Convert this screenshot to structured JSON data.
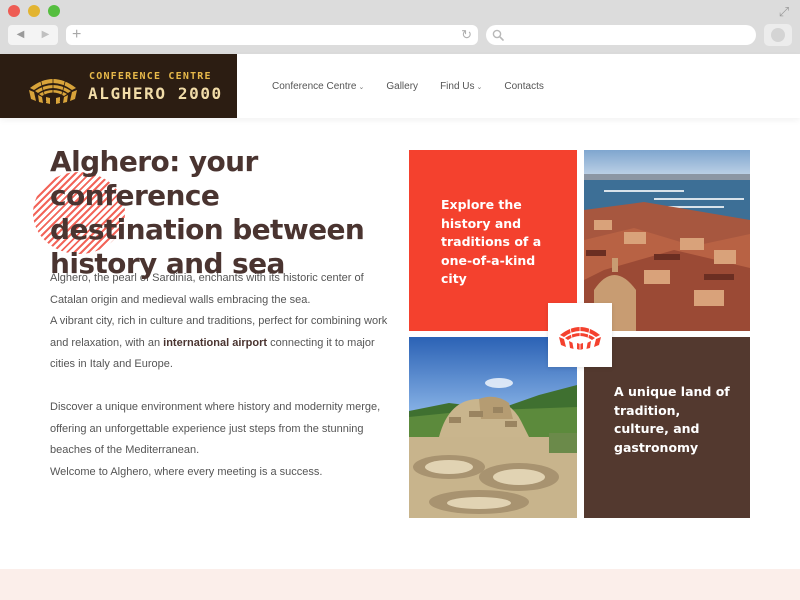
{
  "browser": {
    "back_glyph": "◀",
    "forward_glyph": "▶",
    "new_tab_glyph": "+",
    "reload_glyph": "↻",
    "expand_glyph": "⤢",
    "url": "",
    "search_placeholder": ""
  },
  "site": {
    "logo": {
      "line1": "CONFERENCE CENTRE",
      "line2": "ALGHERO 2000"
    },
    "nav": [
      {
        "label": "Conference Centre",
        "has_dropdown": true
      },
      {
        "label": "Gallery",
        "has_dropdown": false
      },
      {
        "label": "Find Us",
        "has_dropdown": true
      },
      {
        "label": "Contacts",
        "has_dropdown": false
      }
    ],
    "dropdown_glyph": "⌄"
  },
  "content": {
    "title": "Alghero: your conference destination between history and sea",
    "paragraph1_line1": "Alghero, the pearl of Sardinia, enchants with its historic center of Catalan origin and medieval walls embracing the sea.",
    "paragraph1_line2_before": "A vibrant city, rich in culture and traditions, perfect for combining work and relaxation, with an ",
    "paragraph1_line2_bold": "international airport",
    "paragraph1_line2_after": " connecting it to major cities in Italy and Europe.",
    "paragraph2_line1": "Discover a unique environment where history and modernity merge, offering an unforgettable experience just steps from the stunning beaches of the Mediterranean.",
    "paragraph2_line2": "Welcome to Alghero, where every meeting is a success."
  },
  "tiles": {
    "red_text": "Explore the history and traditions of a one-of-a-kind city",
    "brown_text": "A unique land of tradition, culture, and gastronomy"
  },
  "colors": {
    "accent_red": "#f4412e",
    "brown": "#53392f",
    "logo_bg": "#2c1d12",
    "logo_gold": "#e7b94a",
    "title": "#4a3430"
  }
}
